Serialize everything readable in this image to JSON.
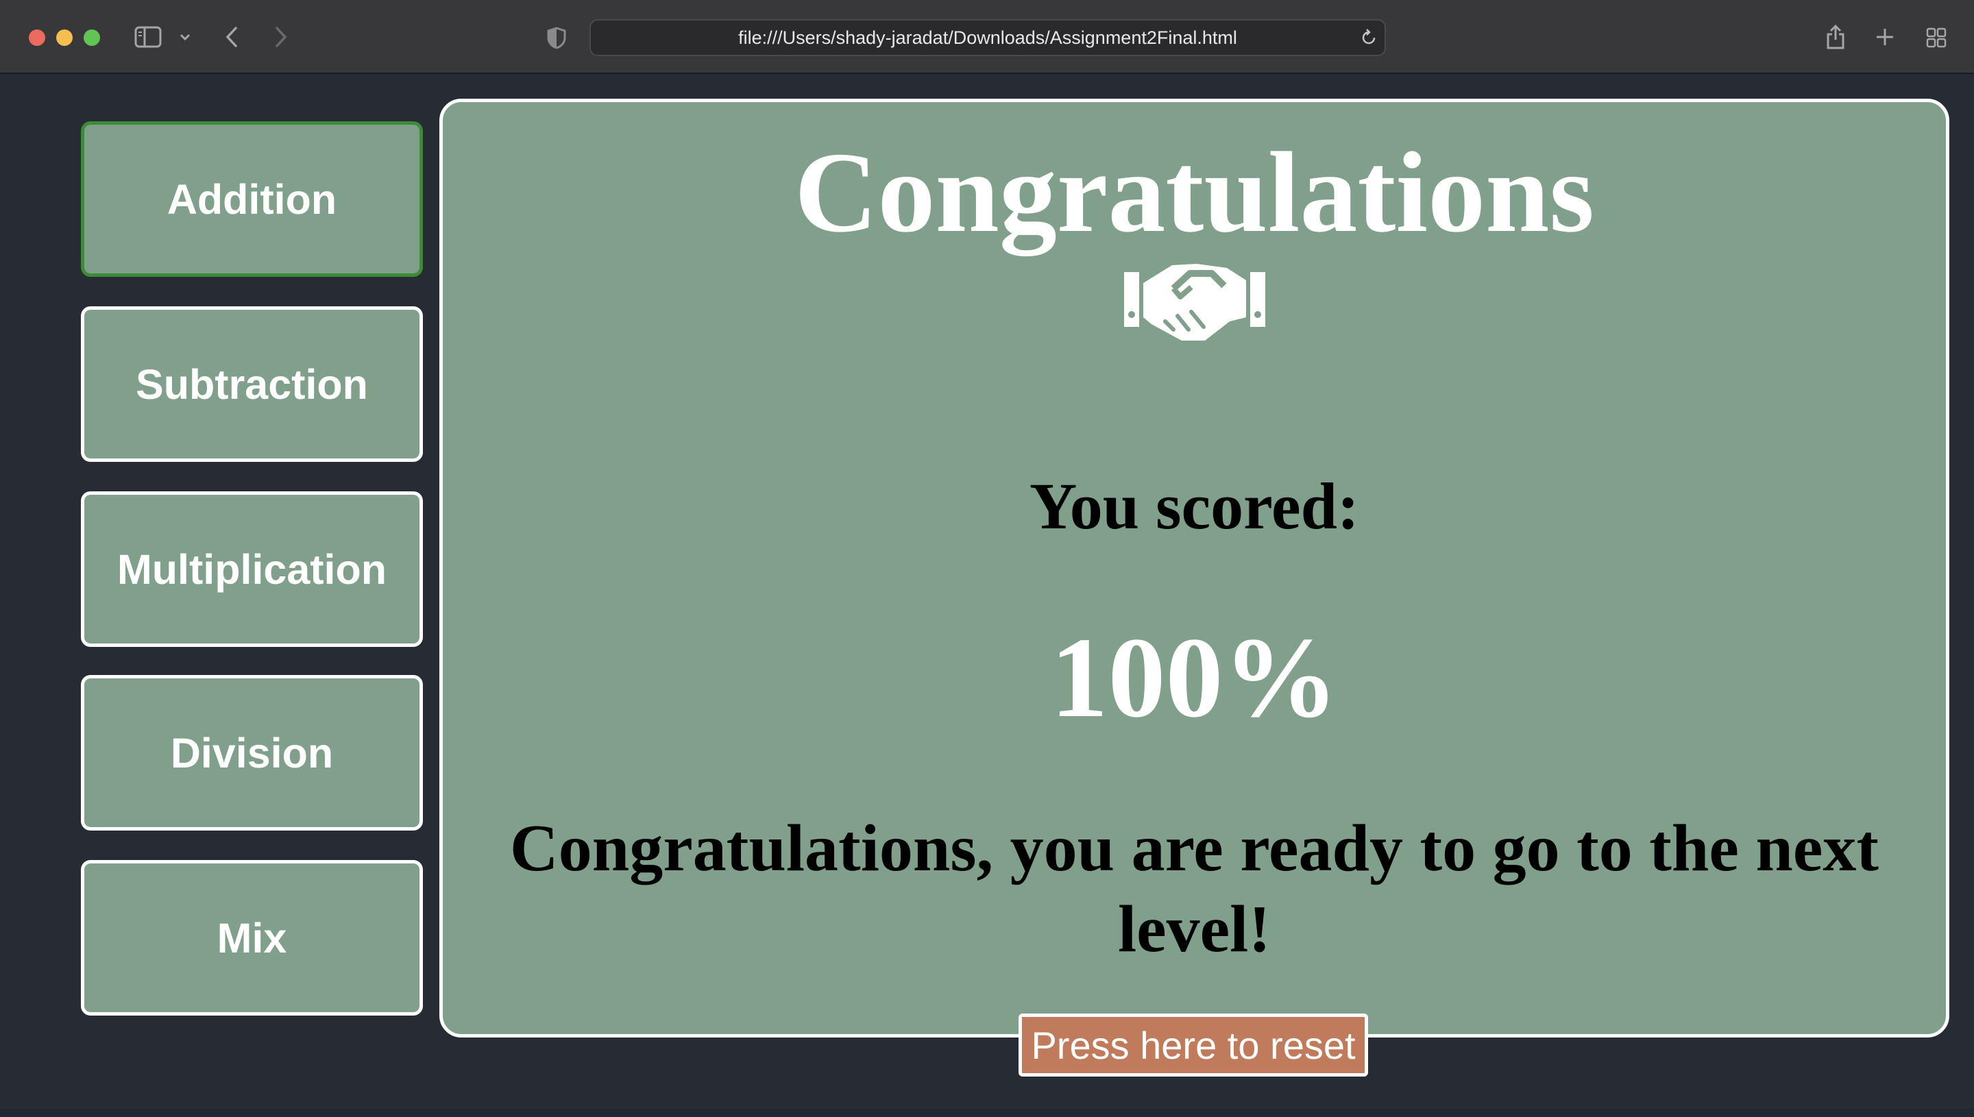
{
  "browser": {
    "url": "file:///Users/shady-jaradat/Downloads/Assignment2Final.html",
    "icons": {
      "sidebar": "sidebar-icon",
      "chevron": "chevron-down-icon",
      "back": "chevron-left-icon",
      "forward": "chevron-right-icon",
      "privacy": "shield-icon",
      "reload": "reload-icon",
      "share": "share-icon",
      "new_tab": "plus-icon",
      "tab_overview": "grid-icon"
    }
  },
  "sidebar": {
    "items": [
      {
        "label": "Addition",
        "active": true
      },
      {
        "label": "Subtraction",
        "active": false
      },
      {
        "label": "Multiplication",
        "active": false
      },
      {
        "label": "Division",
        "active": false
      },
      {
        "label": "Mix",
        "active": false
      }
    ]
  },
  "result": {
    "title": "Congratulations",
    "icon": "handshake-icon",
    "scored_label": "You scored:",
    "score": "100%",
    "message": "Congratulations, you are ready to go to the next level!",
    "reset_label": "Press here to reset"
  },
  "colors": {
    "panel": "#81a08b",
    "background": "#272b33",
    "active_border": "#3d8b34",
    "reset_button": "#bf7b5b"
  }
}
